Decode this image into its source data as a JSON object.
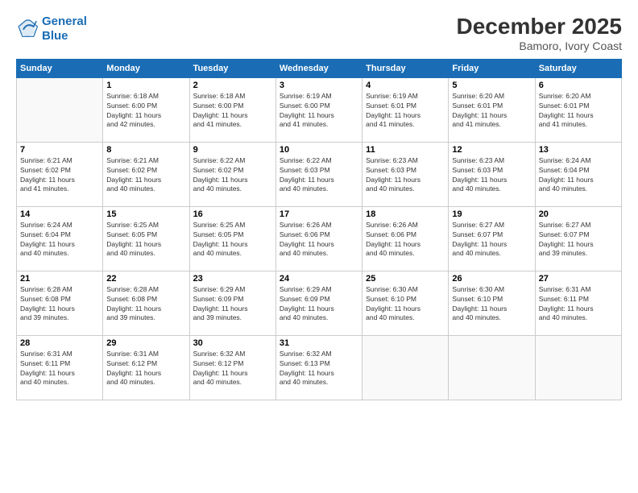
{
  "logo": {
    "line1": "General",
    "line2": "Blue"
  },
  "title": "December 2025",
  "subtitle": "Bamoro, Ivory Coast",
  "weekdays": [
    "Sunday",
    "Monday",
    "Tuesday",
    "Wednesday",
    "Thursday",
    "Friday",
    "Saturday"
  ],
  "weeks": [
    [
      {
        "day": "",
        "info": ""
      },
      {
        "day": "1",
        "info": "Sunrise: 6:18 AM\nSunset: 6:00 PM\nDaylight: 11 hours\nand 42 minutes."
      },
      {
        "day": "2",
        "info": "Sunrise: 6:18 AM\nSunset: 6:00 PM\nDaylight: 11 hours\nand 41 minutes."
      },
      {
        "day": "3",
        "info": "Sunrise: 6:19 AM\nSunset: 6:00 PM\nDaylight: 11 hours\nand 41 minutes."
      },
      {
        "day": "4",
        "info": "Sunrise: 6:19 AM\nSunset: 6:01 PM\nDaylight: 11 hours\nand 41 minutes."
      },
      {
        "day": "5",
        "info": "Sunrise: 6:20 AM\nSunset: 6:01 PM\nDaylight: 11 hours\nand 41 minutes."
      },
      {
        "day": "6",
        "info": "Sunrise: 6:20 AM\nSunset: 6:01 PM\nDaylight: 11 hours\nand 41 minutes."
      }
    ],
    [
      {
        "day": "7",
        "info": "Sunrise: 6:21 AM\nSunset: 6:02 PM\nDaylight: 11 hours\nand 41 minutes."
      },
      {
        "day": "8",
        "info": "Sunrise: 6:21 AM\nSunset: 6:02 PM\nDaylight: 11 hours\nand 40 minutes."
      },
      {
        "day": "9",
        "info": "Sunrise: 6:22 AM\nSunset: 6:02 PM\nDaylight: 11 hours\nand 40 minutes."
      },
      {
        "day": "10",
        "info": "Sunrise: 6:22 AM\nSunset: 6:03 PM\nDaylight: 11 hours\nand 40 minutes."
      },
      {
        "day": "11",
        "info": "Sunrise: 6:23 AM\nSunset: 6:03 PM\nDaylight: 11 hours\nand 40 minutes."
      },
      {
        "day": "12",
        "info": "Sunrise: 6:23 AM\nSunset: 6:03 PM\nDaylight: 11 hours\nand 40 minutes."
      },
      {
        "day": "13",
        "info": "Sunrise: 6:24 AM\nSunset: 6:04 PM\nDaylight: 11 hours\nand 40 minutes."
      }
    ],
    [
      {
        "day": "14",
        "info": "Sunrise: 6:24 AM\nSunset: 6:04 PM\nDaylight: 11 hours\nand 40 minutes."
      },
      {
        "day": "15",
        "info": "Sunrise: 6:25 AM\nSunset: 6:05 PM\nDaylight: 11 hours\nand 40 minutes."
      },
      {
        "day": "16",
        "info": "Sunrise: 6:25 AM\nSunset: 6:05 PM\nDaylight: 11 hours\nand 40 minutes."
      },
      {
        "day": "17",
        "info": "Sunrise: 6:26 AM\nSunset: 6:06 PM\nDaylight: 11 hours\nand 40 minutes."
      },
      {
        "day": "18",
        "info": "Sunrise: 6:26 AM\nSunset: 6:06 PM\nDaylight: 11 hours\nand 40 minutes."
      },
      {
        "day": "19",
        "info": "Sunrise: 6:27 AM\nSunset: 6:07 PM\nDaylight: 11 hours\nand 40 minutes."
      },
      {
        "day": "20",
        "info": "Sunrise: 6:27 AM\nSunset: 6:07 PM\nDaylight: 11 hours\nand 39 minutes."
      }
    ],
    [
      {
        "day": "21",
        "info": "Sunrise: 6:28 AM\nSunset: 6:08 PM\nDaylight: 11 hours\nand 39 minutes."
      },
      {
        "day": "22",
        "info": "Sunrise: 6:28 AM\nSunset: 6:08 PM\nDaylight: 11 hours\nand 39 minutes."
      },
      {
        "day": "23",
        "info": "Sunrise: 6:29 AM\nSunset: 6:09 PM\nDaylight: 11 hours\nand 39 minutes."
      },
      {
        "day": "24",
        "info": "Sunrise: 6:29 AM\nSunset: 6:09 PM\nDaylight: 11 hours\nand 40 minutes."
      },
      {
        "day": "25",
        "info": "Sunrise: 6:30 AM\nSunset: 6:10 PM\nDaylight: 11 hours\nand 40 minutes."
      },
      {
        "day": "26",
        "info": "Sunrise: 6:30 AM\nSunset: 6:10 PM\nDaylight: 11 hours\nand 40 minutes."
      },
      {
        "day": "27",
        "info": "Sunrise: 6:31 AM\nSunset: 6:11 PM\nDaylight: 11 hours\nand 40 minutes."
      }
    ],
    [
      {
        "day": "28",
        "info": "Sunrise: 6:31 AM\nSunset: 6:11 PM\nDaylight: 11 hours\nand 40 minutes."
      },
      {
        "day": "29",
        "info": "Sunrise: 6:31 AM\nSunset: 6:12 PM\nDaylight: 11 hours\nand 40 minutes."
      },
      {
        "day": "30",
        "info": "Sunrise: 6:32 AM\nSunset: 6:12 PM\nDaylight: 11 hours\nand 40 minutes."
      },
      {
        "day": "31",
        "info": "Sunrise: 6:32 AM\nSunset: 6:13 PM\nDaylight: 11 hours\nand 40 minutes."
      },
      {
        "day": "",
        "info": ""
      },
      {
        "day": "",
        "info": ""
      },
      {
        "day": "",
        "info": ""
      }
    ]
  ]
}
